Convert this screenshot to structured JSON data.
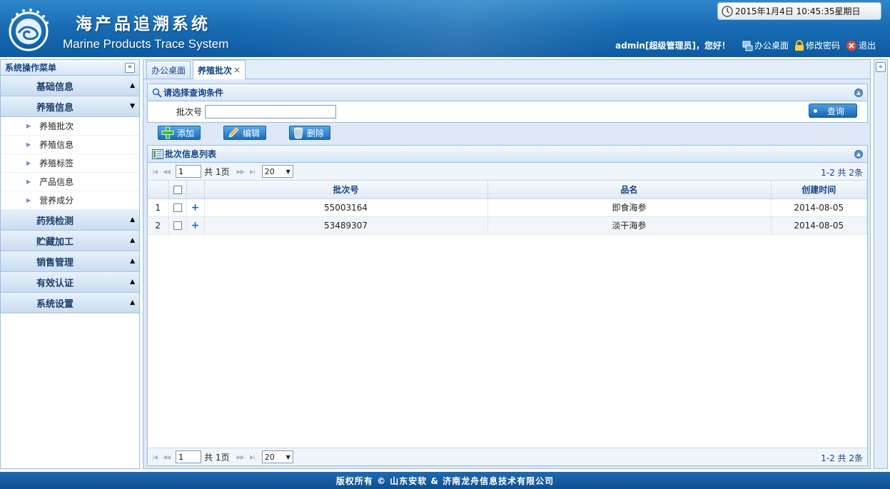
{
  "header": {
    "title_cn": "海产品追溯系统",
    "title_en": "Marine Products Trace System",
    "clock": "2015年1月4日 10:45:35星期日",
    "greeting": "admin[超级管理员]，您好！",
    "desktop_link": "办公桌面",
    "password_link": "修改密码",
    "logout_link": "退出"
  },
  "sidebar": {
    "title": "系统操作菜单",
    "sections": [
      {
        "label": "基础信息",
        "expanded": false
      },
      {
        "label": "养殖信息",
        "expanded": true,
        "items": [
          "养殖批次",
          "养殖信息",
          "养殖标签",
          "产品信息",
          "营养成分"
        ]
      },
      {
        "label": "药残检测",
        "expanded": false
      },
      {
        "label": "贮藏加工",
        "expanded": false
      },
      {
        "label": "销售管理",
        "expanded": false
      },
      {
        "label": "有效认证",
        "expanded": false
      },
      {
        "label": "系统设置",
        "expanded": false
      }
    ]
  },
  "tabs": [
    {
      "label": "办公桌面",
      "active": false
    },
    {
      "label": "养殖批次",
      "active": true,
      "close": "×"
    }
  ],
  "query": {
    "title": "请选择查询条件",
    "field_label": "批次号",
    "field_value": "",
    "button": "查询"
  },
  "toolbar": {
    "add": "添加",
    "edit": "编辑",
    "delete": "删除"
  },
  "grid": {
    "title": "批次信息列表",
    "columns": [
      "批次号",
      "品名",
      "创建时间"
    ],
    "rows": [
      {
        "num": "1",
        "batch": "55003164",
        "name": "即食海参",
        "date": "2014-08-05"
      },
      {
        "num": "2",
        "batch": "53489307",
        "name": "淡干海参",
        "date": "2014-08-05"
      }
    ],
    "pager": {
      "page": "1",
      "total_pages": "共 1页",
      "page_size": "20",
      "summary": "1-2  共 2条"
    }
  },
  "footer": {
    "text": "版权所有 © 山东安软 & 济南龙舟信息技术有限公司"
  },
  "colors": {
    "brand_blue": "#1a6db5",
    "panel_border": "#99bbe8",
    "header_text": "#15428b"
  }
}
